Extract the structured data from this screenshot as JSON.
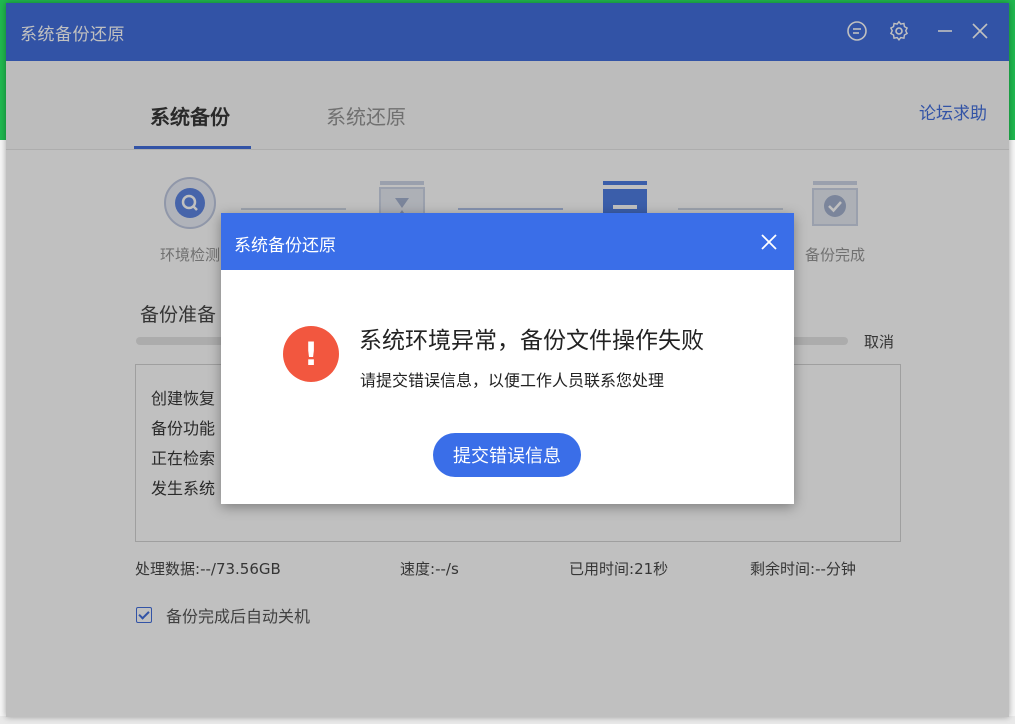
{
  "window": {
    "title": "系统备份还原",
    "controls": [
      "feedback-icon",
      "gear-icon",
      "minimize-icon",
      "close-icon"
    ]
  },
  "tabs": [
    {
      "label": "系统备份",
      "active": true
    },
    {
      "label": "系统还原",
      "active": false
    }
  ],
  "help_link": "论坛求助",
  "steps": [
    {
      "label": "环境检测",
      "icon": "search-icon"
    },
    {
      "label": "",
      "icon": "hourglass-icon"
    },
    {
      "label": "",
      "icon": "drive-icon"
    },
    {
      "label": "备份完成",
      "icon": "check-icon"
    }
  ],
  "prep_title": "备份准备",
  "cancel_label": "取消",
  "log_lines": [
    "创建恢复",
    "备份功能",
    "正在检索",
    "发生系统"
  ],
  "stats": {
    "data_label": "处理数据:",
    "data_value": "--/73.56GB",
    "speed_label": "速度:",
    "speed_value": "--/s",
    "elapsed_label": "已用时间:",
    "elapsed_value": "21秒",
    "remaining_label": "剩余时间:",
    "remaining_value": "--分钟"
  },
  "auto_shutdown": {
    "label": "备份完成后自动关机",
    "checked": true
  },
  "dialog": {
    "title": "系统备份还原",
    "message": "系统环境异常，备份文件操作失败",
    "sub_message": "请提交错误信息，以便工作人员联系您处理",
    "button_label": "提交错误信息",
    "error_symbol": "!"
  },
  "colors": {
    "accent": "#2e5fd9",
    "dialog_header": "#3a6ee8",
    "error": "#f2573f",
    "desktop_green": "#20b84f"
  }
}
